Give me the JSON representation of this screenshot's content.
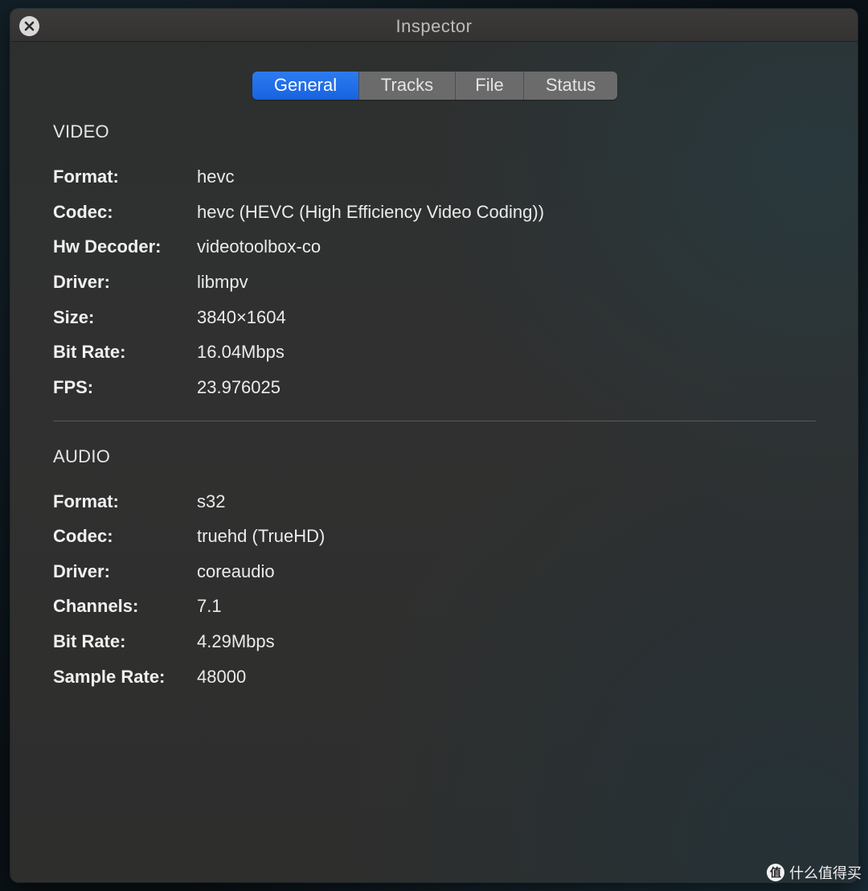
{
  "window": {
    "title": "Inspector"
  },
  "tabs": [
    {
      "label": "General",
      "active": true
    },
    {
      "label": "Tracks",
      "active": false
    },
    {
      "label": "File",
      "active": false
    },
    {
      "label": "Status",
      "active": false
    }
  ],
  "video": {
    "heading": "VIDEO",
    "rows": [
      {
        "label": "Format:",
        "value": "hevc"
      },
      {
        "label": "Codec:",
        "value": "hevc (HEVC (High Efficiency Video Coding))"
      },
      {
        "label": "Hw Decoder:",
        "value": "videotoolbox-co"
      },
      {
        "label": "Driver:",
        "value": "libmpv"
      },
      {
        "label": "Size:",
        "value": "3840×1604"
      },
      {
        "label": "Bit Rate:",
        "value": "16.04Mbps"
      },
      {
        "label": "FPS:",
        "value": "23.976025"
      }
    ]
  },
  "audio": {
    "heading": "AUDIO",
    "rows": [
      {
        "label": "Format:",
        "value": "s32"
      },
      {
        "label": "Codec:",
        "value": "truehd (TrueHD)"
      },
      {
        "label": "Driver:",
        "value": "coreaudio"
      },
      {
        "label": "Channels:",
        "value": "7.1"
      },
      {
        "label": "Bit Rate:",
        "value": "4.29Mbps"
      },
      {
        "label": "Sample Rate:",
        "value": "48000"
      }
    ]
  },
  "watermark": {
    "logo": "值",
    "text": "什么值得买"
  },
  "colors": {
    "accent": "#1f6fe8",
    "window_bg": "#2f2f2f",
    "tab_inactive": "#6b6b6b"
  },
  "icons": {
    "close": "close-icon"
  }
}
